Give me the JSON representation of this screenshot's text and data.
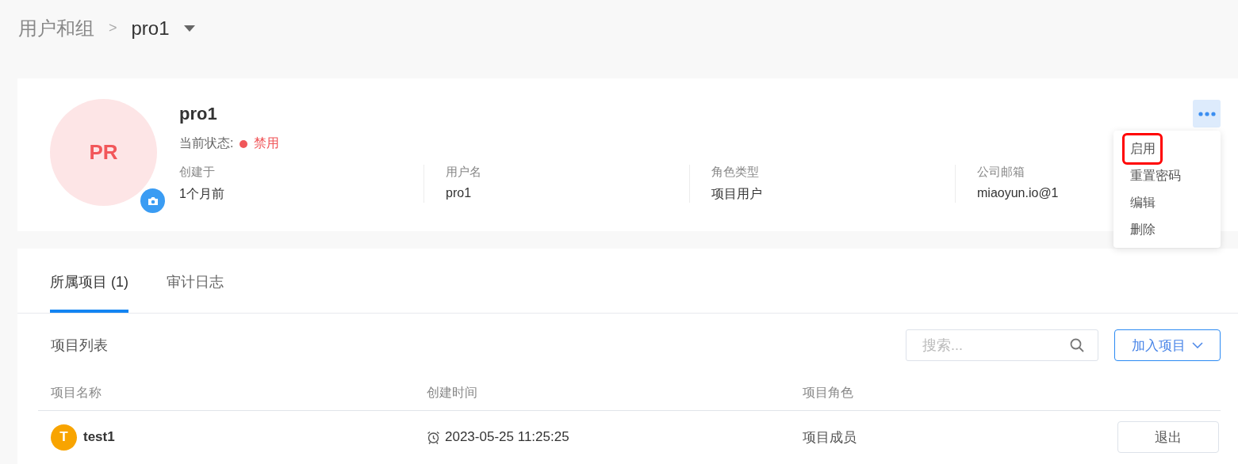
{
  "breadcrumb": {
    "parent": "用户和组",
    "separator": ">",
    "current": "pro1"
  },
  "profile": {
    "avatar_initials": "PR",
    "name": "pro1",
    "status_label": "当前状态:",
    "status": "禁用",
    "fields": [
      {
        "label": "创建于",
        "value": "1个月前"
      },
      {
        "label": "用户名",
        "value": "pro1"
      },
      {
        "label": "角色类型",
        "value": "项目用户"
      },
      {
        "label": "公司邮箱",
        "value": "miaoyun.io@1"
      }
    ]
  },
  "more_menu": {
    "expanded": true,
    "items": [
      {
        "label": "启用",
        "highlighted": true
      },
      {
        "label": "重置密码",
        "highlighted": false
      },
      {
        "label": "编辑",
        "highlighted": false
      },
      {
        "label": "删除",
        "highlighted": false
      }
    ]
  },
  "tabs": [
    {
      "label": "所属项目 (1)",
      "selected": true
    },
    {
      "label": "审计日志",
      "selected": false
    }
  ],
  "project_list": {
    "title": "项目列表",
    "search": {
      "placeholder": "搜索..."
    },
    "add_button": "加入项目",
    "columns": [
      "项目名称",
      "创建时间",
      "项目角色"
    ],
    "rows": [
      {
        "initial": "T",
        "name": "test1",
        "created": "2023-05-25 11:25:25",
        "role": "项目成员",
        "action": "退出"
      }
    ]
  }
}
